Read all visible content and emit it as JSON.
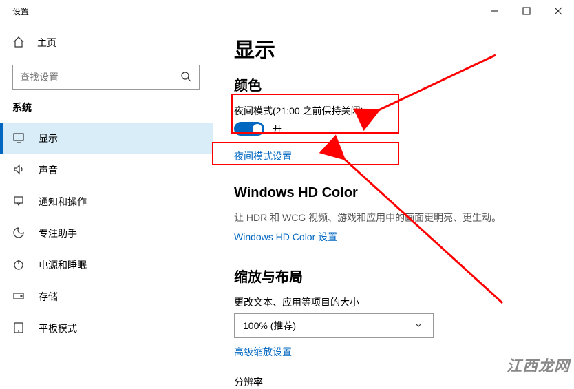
{
  "titlebar": {
    "label": "设置"
  },
  "home": {
    "label": "主页"
  },
  "search": {
    "placeholder": "查找设置"
  },
  "sidebar": {
    "section": "系统",
    "items": [
      {
        "id": "display",
        "label": "显示",
        "selected": true
      },
      {
        "id": "sound",
        "label": "声音"
      },
      {
        "id": "notifications",
        "label": "通知和操作"
      },
      {
        "id": "focus",
        "label": "专注助手"
      },
      {
        "id": "power",
        "label": "电源和睡眠"
      },
      {
        "id": "storage",
        "label": "存储"
      },
      {
        "id": "tablet",
        "label": "平板模式"
      }
    ]
  },
  "content": {
    "heading": "显示",
    "color": {
      "title": "颜色",
      "nightlight_label": "夜间模式(21:00 之前保持关闭)",
      "toggle_state": "开",
      "settings_link": "夜间模式设置"
    },
    "hd": {
      "title": "Windows HD Color",
      "desc": "让 HDR 和 WCG 视频、游戏和应用中的画面更明亮、更生动。",
      "link": "Windows HD Color 设置"
    },
    "scale": {
      "title": "缩放与布局",
      "change_label": "更改文本、应用等项目的大小",
      "value": "100% (推荐)",
      "advanced_link": "高级缩放设置",
      "resolution": "分辨率"
    }
  },
  "watermark": "江西龙网"
}
